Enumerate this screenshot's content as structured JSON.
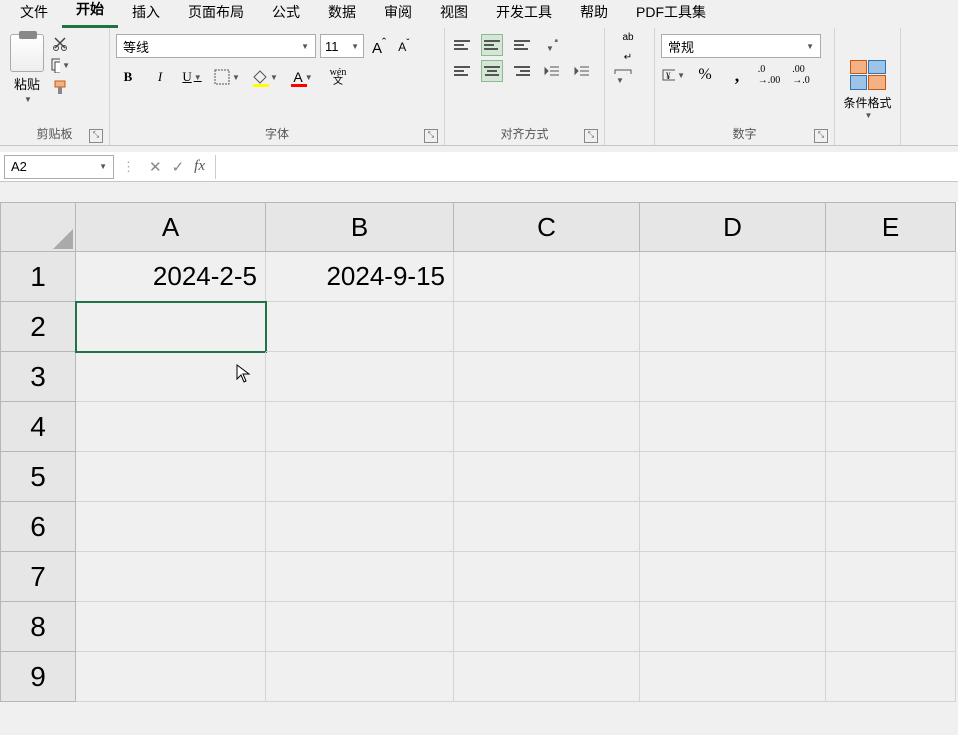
{
  "menubar": {
    "items": [
      "文件",
      "开始",
      "插入",
      "页面布局",
      "公式",
      "数据",
      "审阅",
      "视图",
      "开发工具",
      "帮助",
      "PDF工具集"
    ],
    "active_index": 1
  },
  "ribbon": {
    "clipboard": {
      "paste": "粘贴",
      "label": "剪贴板"
    },
    "font": {
      "name": "等线",
      "size": "11",
      "bold": "B",
      "italic": "I",
      "underline": "U",
      "phonetic": "wén 文",
      "label": "字体"
    },
    "alignment": {
      "label": "对齐方式",
      "wrap": "ab"
    },
    "number": {
      "format": "常规",
      "label": "数字"
    },
    "cond": {
      "label": "条件格式"
    }
  },
  "formula_bar": {
    "name_box": "A2",
    "cancel": "✕",
    "enter": "✓",
    "fx": "fx",
    "value": ""
  },
  "sheet": {
    "columns": [
      "A",
      "B",
      "C",
      "D",
      "E"
    ],
    "rows": [
      "1",
      "2",
      "3",
      "4",
      "5",
      "6",
      "7",
      "8",
      "9"
    ],
    "cells": {
      "A1": "2024-2-5",
      "B1": "2024-9-15"
    },
    "selected": "A2"
  }
}
